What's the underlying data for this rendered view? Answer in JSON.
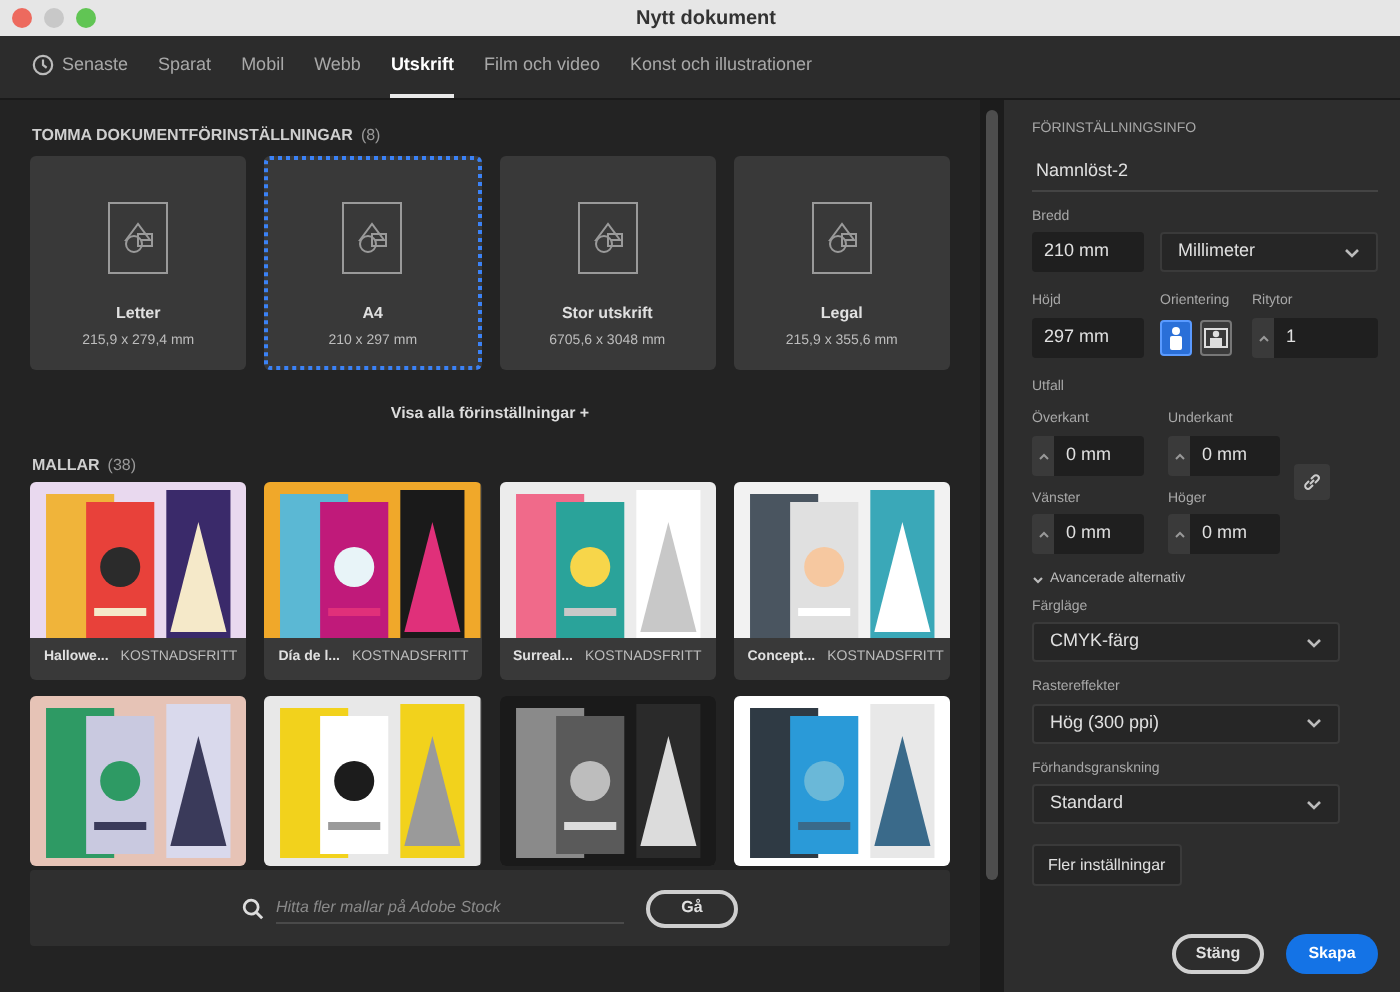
{
  "window": {
    "title": "Nytt dokument"
  },
  "tabs": [
    {
      "kind": "history",
      "label": "Senaste",
      "selected": false
    },
    {
      "kind": "category",
      "label": "Sparat",
      "selected": false
    },
    {
      "kind": "category",
      "label": "Mobil",
      "selected": false
    },
    {
      "kind": "category",
      "label": "Webb",
      "selected": false
    },
    {
      "kind": "category",
      "label": "Utskrift",
      "selected": true
    },
    {
      "kind": "category",
      "label": "Film och video",
      "selected": false
    },
    {
      "kind": "category",
      "label": "Konst och illustrationer",
      "selected": false
    }
  ],
  "presets": {
    "heading": "TOMMA DOKUMENTFÖRINSTÄLLNINGAR",
    "count": "(8)",
    "show_all": "Visa alla förinställningar +",
    "items": [
      {
        "name": "Letter",
        "size": "215,9 x 279,4 mm",
        "selected": false
      },
      {
        "name": "A4",
        "size": "210 x 297 mm",
        "selected": true
      },
      {
        "name": "Stor utskrift",
        "size": "6705,6 x 3048 mm",
        "selected": false
      },
      {
        "name": "Legal",
        "size": "215,9 x 355,6 mm",
        "selected": false
      }
    ]
  },
  "templates": {
    "heading": "MALLAR",
    "count": "(38)",
    "items": [
      {
        "kind": "captioned",
        "title": "Hallowe...",
        "badge": "KOSTNADSFRITT"
      },
      {
        "kind": "captioned",
        "title": "Día de l...",
        "badge": "KOSTNADSFRITT"
      },
      {
        "kind": "captioned",
        "title": "Surreal...",
        "badge": "KOSTNADSFRITT"
      },
      {
        "kind": "captioned",
        "title": "Concept...",
        "badge": "KOSTNADSFRITT"
      },
      {
        "kind": "picture"
      },
      {
        "kind": "picture"
      },
      {
        "kind": "picture"
      },
      {
        "kind": "picture"
      }
    ]
  },
  "search": {
    "placeholder": "Hitta fler mallar på Adobe Stock",
    "button": "Gå"
  },
  "panel": {
    "heading": "FÖRINSTÄLLNINGSINFO",
    "name": "Namnlöst-2",
    "width": {
      "label": "Bredd",
      "value": "210 mm",
      "unit": "Millimeter"
    },
    "height": {
      "label": "Höjd",
      "value": "297 mm"
    },
    "orientation": {
      "label": "Orientering",
      "options": [
        {
          "kind": "portrait",
          "selected": true
        },
        {
          "kind": "landscape",
          "selected": false
        }
      ]
    },
    "artboards": {
      "label": "Ritytor",
      "value": "1"
    },
    "bleed": {
      "label": "Utfall",
      "fields": [
        {
          "label": "Överkant",
          "value": "0 mm"
        },
        {
          "label": "Underkant",
          "value": "0 mm"
        },
        {
          "label": "Vänster",
          "value": "0 mm"
        },
        {
          "label": "Höger",
          "value": "0 mm"
        }
      ]
    },
    "advanced": {
      "label": "Avancerade alternativ",
      "expanded": true
    },
    "selects": [
      {
        "label": "Färgläge",
        "value": "CMYK-färg"
      },
      {
        "label": "Rastereffekter",
        "value": "Hög (300 ppi)"
      },
      {
        "label": "Förhandsgranskning",
        "value": "Standard"
      }
    ],
    "more_button": "Fler inställningar",
    "buttons": {
      "cancel": "Stäng",
      "create": "Skapa"
    }
  }
}
